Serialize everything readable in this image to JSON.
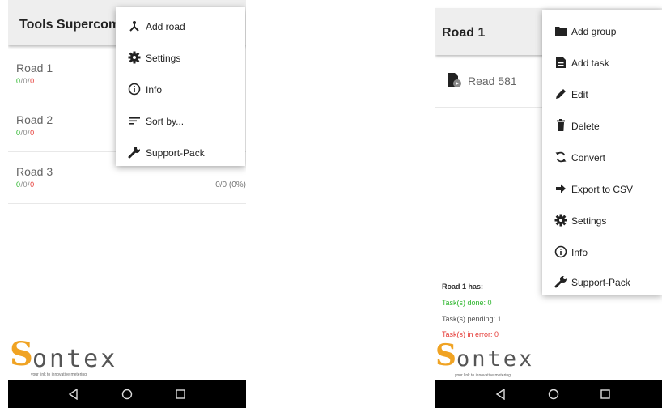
{
  "left": {
    "appbar_title": "Tools Supercom",
    "roads": [
      {
        "name": "Road 1",
        "done": "0",
        "pending": "0",
        "error": "0",
        "progress": ""
      },
      {
        "name": "Road 2",
        "done": "0",
        "pending": "0",
        "error": "0",
        "progress": ""
      },
      {
        "name": "Road 3",
        "done": "0",
        "pending": "0",
        "error": "0",
        "progress": "0/0 (0%)"
      }
    ],
    "count_separator": "/",
    "menu": [
      {
        "label": "Add road",
        "icon": "add-road-icon"
      },
      {
        "label": "Settings",
        "icon": "gear-icon"
      },
      {
        "label": "Info",
        "icon": "info-icon"
      },
      {
        "label": "Sort by...",
        "icon": "sort-icon"
      },
      {
        "label": "Support-Pack",
        "icon": "wrench-icon"
      }
    ]
  },
  "right": {
    "appbar_title": "Road 1",
    "task": {
      "name": "Read 581",
      "icon": "document-pending-icon"
    },
    "menu": [
      {
        "label": "Add group",
        "icon": "folder-icon"
      },
      {
        "label": "Add task",
        "icon": "file-icon"
      },
      {
        "label": "Edit",
        "icon": "pencil-icon"
      },
      {
        "label": "Delete",
        "icon": "trash-icon"
      },
      {
        "label": "Convert",
        "icon": "sync-icon"
      },
      {
        "label": "Export to CSV",
        "icon": "arrow-right-icon"
      },
      {
        "label": "Settings",
        "icon": "gear-icon"
      },
      {
        "label": "Info",
        "icon": "info-icon"
      },
      {
        "label": "Support-Pack",
        "icon": "wrench-icon"
      }
    ],
    "summary": {
      "header": "Road 1  has:",
      "done": "Task(s) done: 0",
      "pending": "Task(s) pending: 1",
      "error": "Task(s) in error: 0"
    }
  },
  "logo": {
    "s": "S",
    "text": "ontex",
    "tagline": "your link to innovative metering"
  },
  "colors": {
    "done": "#2bb52b",
    "error": "#e53935",
    "logo_accent": "#f0a323",
    "appbar": "#eeeeee"
  },
  "navbar": {
    "icons": [
      "back-icon",
      "home-icon",
      "recents-icon"
    ]
  }
}
